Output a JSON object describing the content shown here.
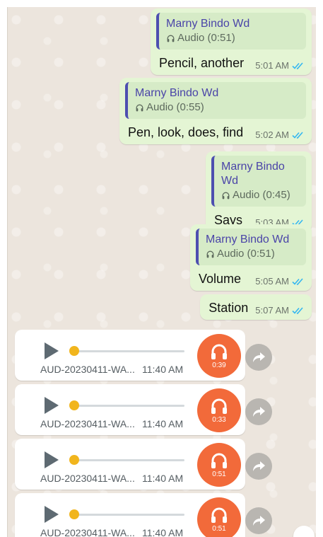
{
  "messages": [
    {
      "quote_name": "Marny Bindo Wd",
      "quote_label": "Audio (0:51)",
      "text": "Pencil, another",
      "time": "5:01 AM"
    },
    {
      "quote_name": "Marny Bindo Wd",
      "quote_label": "Audio (0:55)",
      "text": "Pen, look, does, find",
      "time": "5:02 AM"
    },
    {
      "quote_name": "Marny Bindo Wd",
      "quote_label": "Audio (0:45)",
      "text": "Says",
      "time": "5:03 AM"
    },
    {
      "quote_name": "Marny Bindo Wd",
      "quote_label": "Audio (0:51)",
      "text": "Volume",
      "time": "5:05 AM"
    }
  ],
  "simple_message": {
    "text": "Station",
    "time": "5:07 AM"
  },
  "audio_files": [
    {
      "file_name": "AUD-20230411-WA...",
      "time": "11:40 AM",
      "duration": "0:39",
      "progress": 0
    },
    {
      "file_name": "AUD-20230411-WA...",
      "time": "11:40 AM",
      "duration": "0:33",
      "progress": 0
    },
    {
      "file_name": "AUD-20230411-WA...",
      "time": "11:40 AM",
      "duration": "0:51",
      "progress": 0
    },
    {
      "file_name": "AUD-20230411-WA...",
      "time": "11:40 AM",
      "duration": "0:51",
      "progress": 0
    }
  ],
  "colors": {
    "outgoing_bubble": "#e4f5d4",
    "quote_accent": "#4d4fb0",
    "read_ticks": "#34b7f1",
    "audio_avatar": "#f26a3a",
    "progress_knob": "#f1b51d"
  },
  "icons": {
    "quote_audio": "headphones-icon",
    "read_receipt": "double-check-icon",
    "play": "play-icon",
    "avatar": "headphones-icon",
    "forward": "forward-icon"
  }
}
